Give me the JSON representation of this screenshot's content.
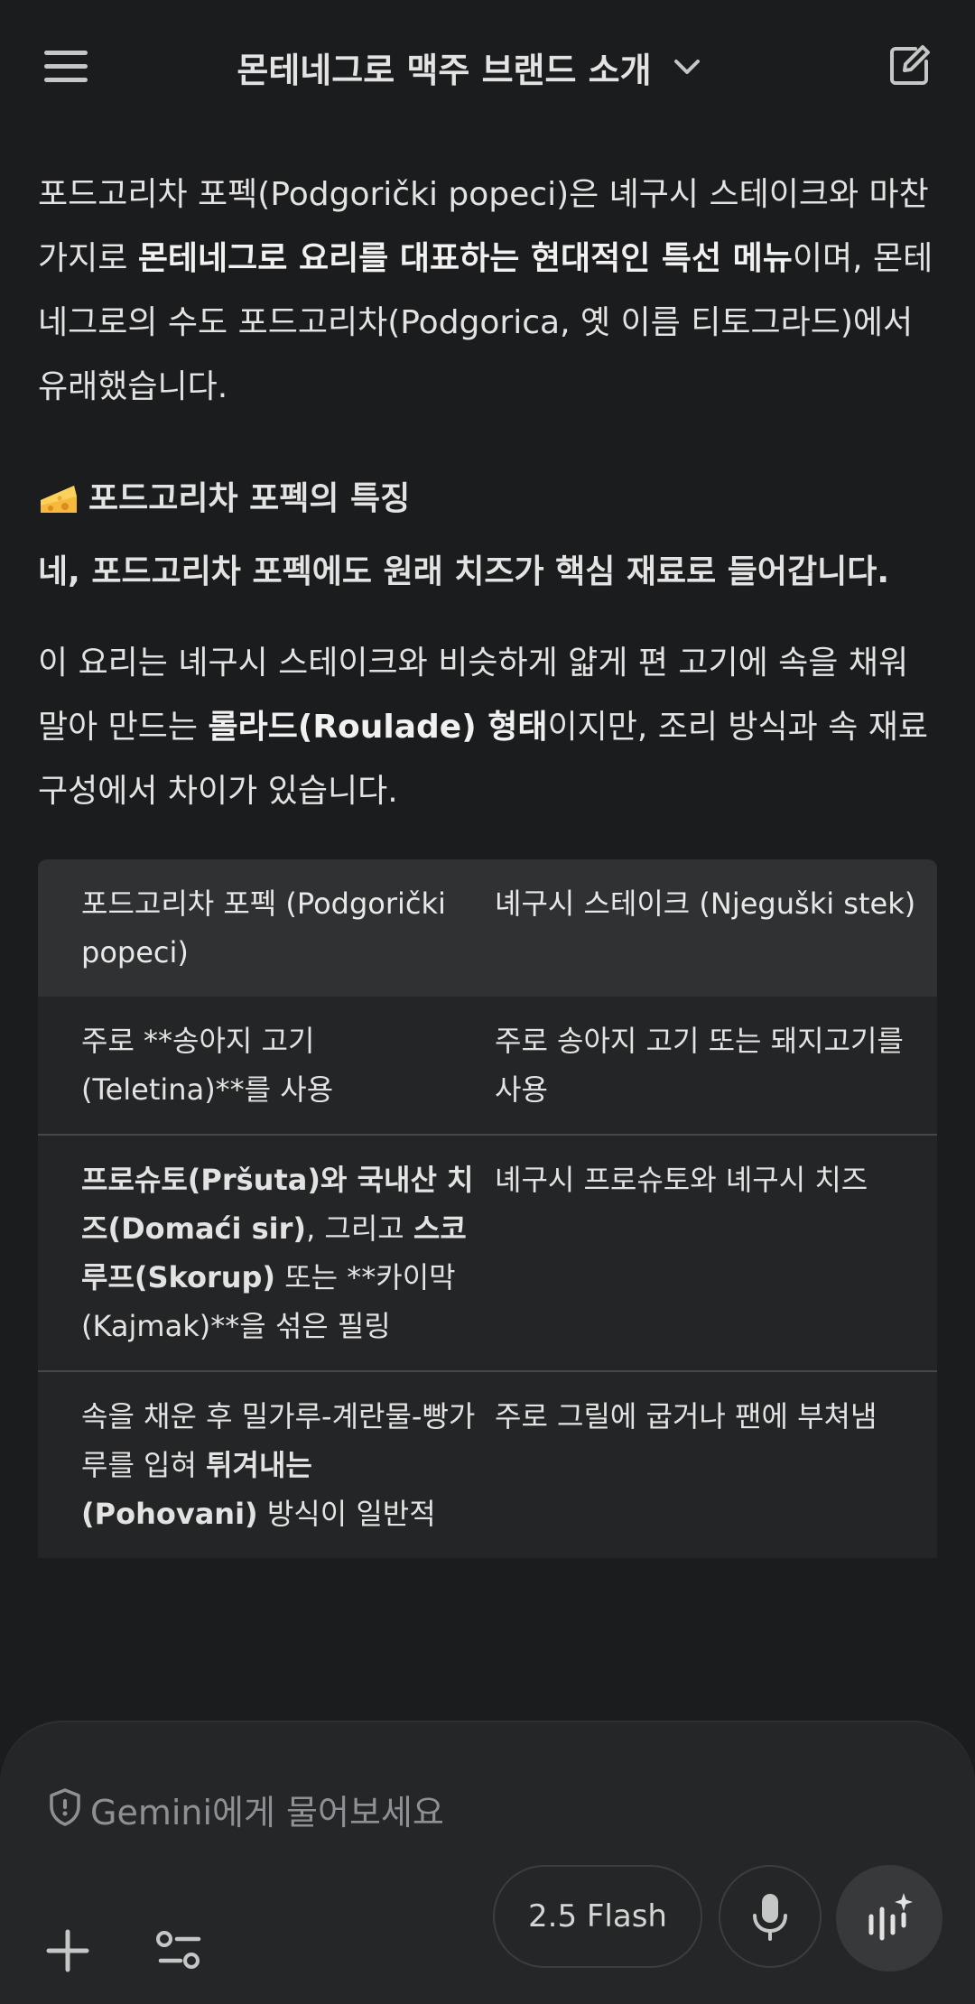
{
  "header": {
    "title": "몬테네그로 맥주 브랜드 소개"
  },
  "content": {
    "intro_parts": [
      "포드고리차 포펙(Podgorički popeci)은 녜구시 스테이크와 마찬가지로 ",
      "몬테네그로 요리를 대표하는 현대적인 특선 메뉴",
      "이며, 몬테네그로의 수도 포드고리차(Podgorica, 옛 이름 티토그라드)에서 유래했습니다."
    ],
    "section_heading": "포드고리차 포펙의 특징",
    "bold_para": "네, 포드고리차 포펙에도 원래 치즈가 핵심 재료로 들어갑니다.",
    "desc_parts": [
      "이 요리는 녜구시 스테이크와 비슷하게 얇게 편 고기에 속을 채워 말아 만드는 ",
      "롤라드(Roulade) 형태",
      "이지만, 조리 방식과 속 재료 구성에서 차이가 있습니다."
    ],
    "table": {
      "headers": [
        "포드고리차 포펙 (Podgorički popeci)",
        "녜구시 스테이크 (Njeguški stek)"
      ],
      "row1": {
        "c1": "주로 **송아지 고기(Teletina)**를 사용",
        "c2": "주로 송아지 고기 또는 돼지고기를 사용"
      },
      "row2": {
        "c1_parts": [
          "프로슈토(Pršuta)",
          "와 ",
          "국내산 치즈(Domaći sir)",
          ", 그리고 ",
          "스코루프(Skorup)",
          " 또는 **카이막(Kajmak)**을 섞은 필링"
        ],
        "c2": "녜구시 프로슈토와 녜구시 치즈"
      },
      "row3": {
        "c1_parts": [
          "속을 채운 후 밀가루-계란물-빵가루를 입혀 ",
          "튀겨내는(Pohovani)",
          " 방식이 일반적"
        ],
        "c2": "주로 그릴에 굽거나 팬에 부쳐냄"
      }
    }
  },
  "composer": {
    "placeholder": "Gemini에게 물어보세요",
    "model_label": "2.5 Flash"
  },
  "colors": {
    "background": "#1b1c1d",
    "composer": "#252627",
    "table_header": "#303133",
    "table_body": "#242526"
  },
  "icons": [
    "menu-icon",
    "chevron-down-icon",
    "edit-icon",
    "cheese-icon",
    "shield-icon",
    "plus-icon",
    "tools-icon",
    "mic-icon",
    "live-icon"
  ]
}
